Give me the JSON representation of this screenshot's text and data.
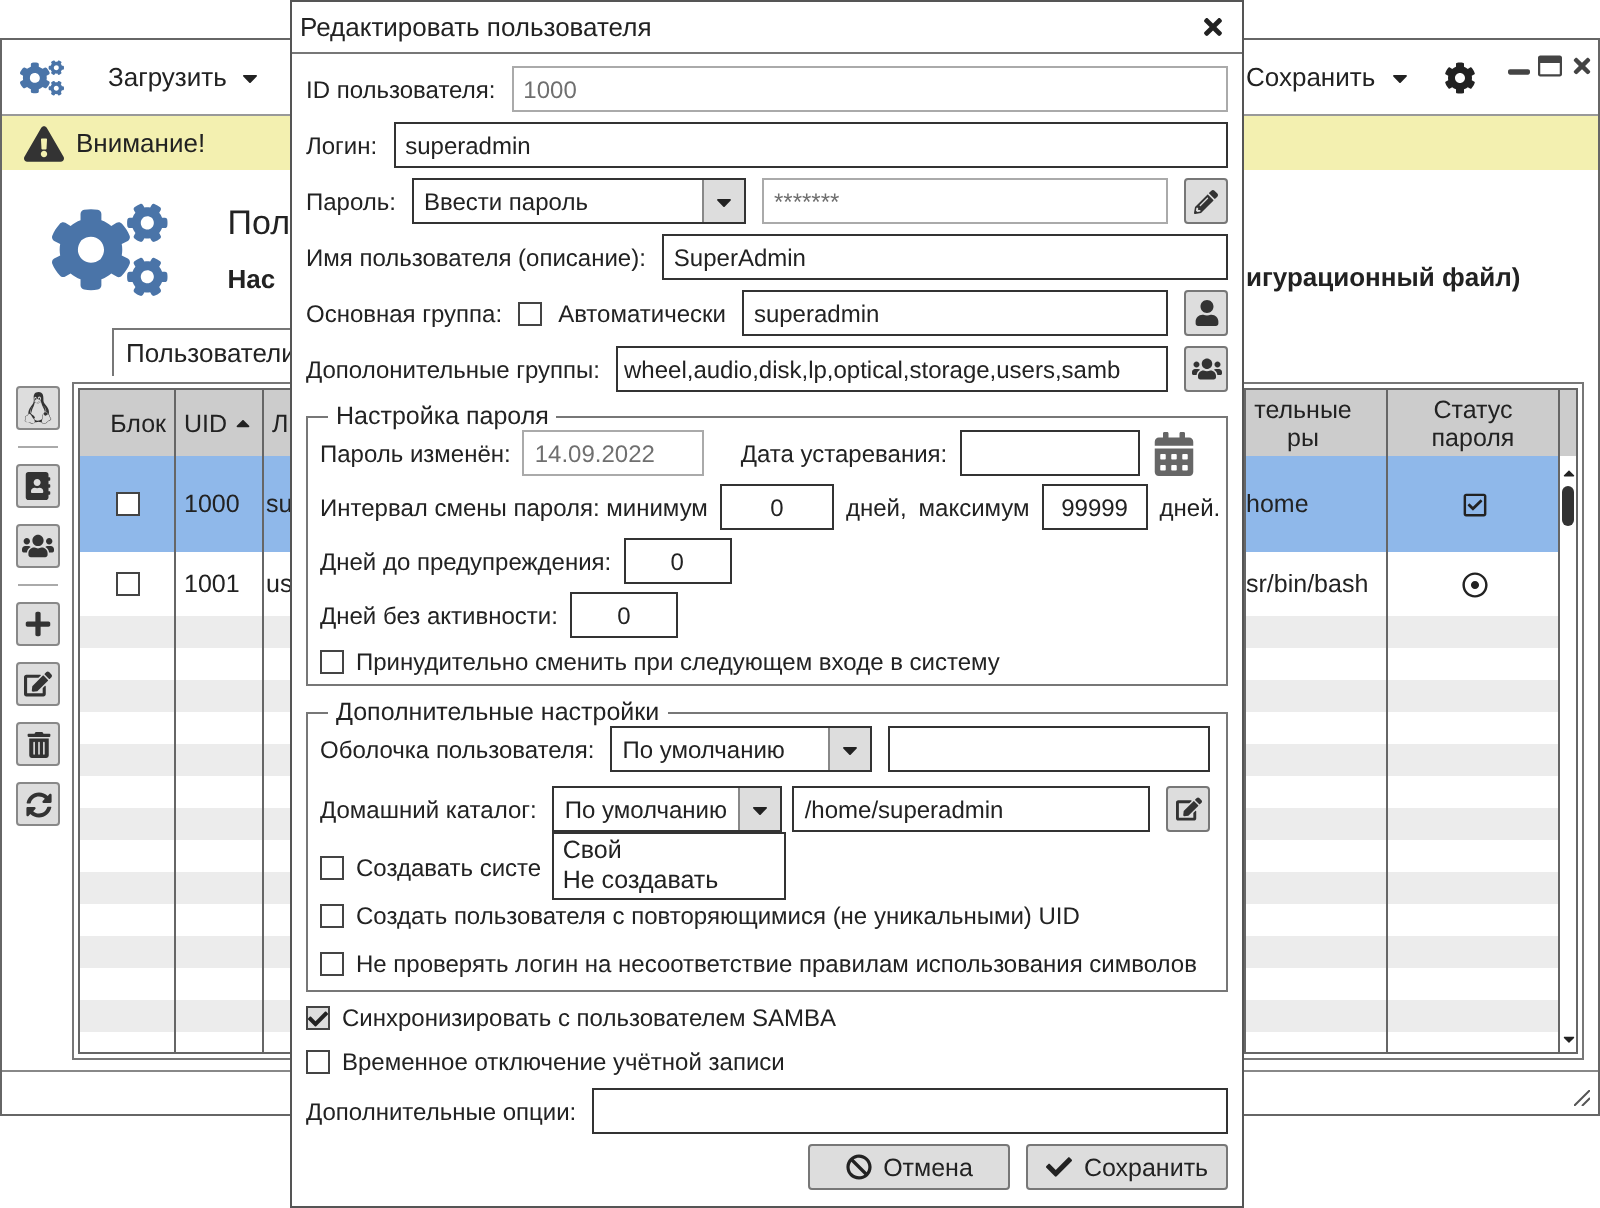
{
  "main_window": {
    "toolbar": {
      "load_menu": "Загрузить",
      "save_menu": "Сохранить"
    },
    "warning": "Внимание!",
    "header": {
      "title": "Пол",
      "subtitle": "Нас",
      "subtitle_end": "игурационный файл)"
    },
    "tabs": [
      {
        "label": "Пользователи",
        "selected": true
      }
    ],
    "table": {
      "columns": [
        {
          "label": "Блок"
        },
        {
          "label": "UID",
          "sort_ascending": true
        },
        {
          "label": "Л"
        },
        {
          "label": "тельные ры"
        },
        {
          "label": "Статус пароля"
        }
      ],
      "rows": [
        {
          "selected": true,
          "blocked": false,
          "uid": "1000",
          "login": "su",
          "column_4": "home",
          "password_confirmed": true
        },
        {
          "selected": false,
          "blocked": false,
          "uid": "1001",
          "login": "us",
          "column_4": "sr/bin/bash",
          "password_confirmed": false
        }
      ]
    }
  },
  "dialog": {
    "title": "Редактировать пользователя",
    "user_id": {
      "label": "ID пользователя:",
      "value": "1000",
      "disabled": true
    },
    "login": {
      "label": "Логин:",
      "value": "superadmin",
      "disabled": false
    },
    "password": {
      "label": "Пароль:",
      "mode": "Ввести пароль",
      "value": "*******",
      "disabled": true
    },
    "description": {
      "label": "Имя пользователя (описание):",
      "value": "SuperAdmin",
      "disabled": false
    },
    "primary_group": {
      "label": "Основная группа:",
      "auto_label": "Автоматически",
      "auto_checked": false,
      "value": "superadmin"
    },
    "extra_groups": {
      "label": "Дополонительные группы:",
      "value": "wheel,audio,disk,lp,optical,storage,users,samb"
    },
    "password_settings": {
      "legend": "Настройка пароля",
      "changed_label": "Пароль изменён:",
      "changed_value": "14.09.2022",
      "expiry_label": "Дата устаревания:",
      "interval_label": "Интервал смены пароля: минимум",
      "min_value": "0",
      "days_label_1": "дней,",
      "max_label": "максимум",
      "max_value": "99999",
      "days_label_2": "дней.",
      "warn_label": "Дней до предупреждения:",
      "warn_value": "0",
      "inactive_label": "Дней без активности:",
      "inactive_value": "0",
      "force_change": {
        "label": "Принудительно сменить при следующем входе в систему",
        "checked": false
      }
    },
    "extra_settings": {
      "legend": "Дополнительные настройки",
      "shell_label": "Оболочка пользователя:",
      "shell_value": "По умолчанию",
      "home_label": "Домашний каталог:",
      "home_mode": "По умолчанию",
      "home_expanded": true,
      "home_options": [
        "Свой",
        "Не создавать"
      ],
      "home_value": "/home/superadmin",
      "checks": [
        {
          "label": "Создавать систе",
          "checked": false
        },
        {
          "label": "Создать пользователя с повторяющимися (не уникальными) UID",
          "checked": false
        },
        {
          "label": "Не проверять логин на несоответствие правилам использования символов",
          "checked": false
        }
      ]
    },
    "samba": {
      "label": "Синхронизировать с пользователем SAMBA",
      "checked": true
    },
    "disable_account": {
      "label": "Временное отключение учётной записи",
      "checked": false
    },
    "options_label": "Дополнительные опции:",
    "buttons": [
      {
        "kind": "cancel",
        "label": "Отмена"
      },
      {
        "kind": "save",
        "label": "Сохранить"
      }
    ]
  }
}
